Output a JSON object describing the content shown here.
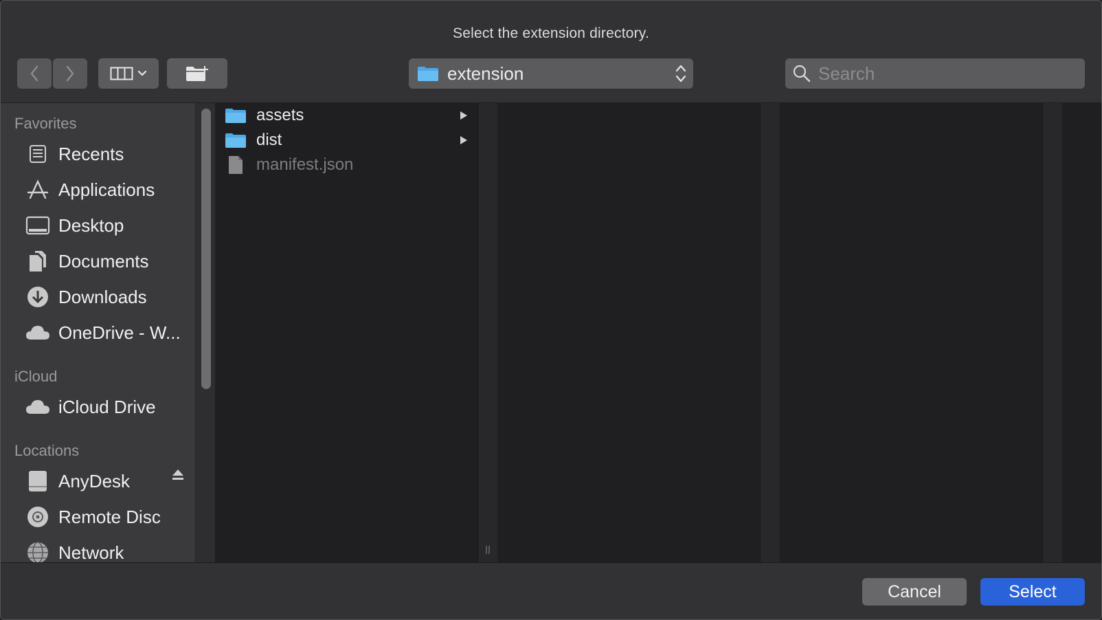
{
  "dialog": {
    "title": "Select the extension directory."
  },
  "toolbar": {
    "back_icon": "chevron-left-icon",
    "forward_icon": "chevron-right-icon",
    "view_icon": "column-view-icon",
    "new_folder_icon": "new-folder-icon",
    "path_label": "extension",
    "search_placeholder": "Search"
  },
  "sidebar": {
    "favorites_header": "Favorites",
    "favorites": [
      {
        "label": "Recents",
        "icon": "recents-icon"
      },
      {
        "label": "Applications",
        "icon": "applications-icon"
      },
      {
        "label": "Desktop",
        "icon": "desktop-icon"
      },
      {
        "label": "Documents",
        "icon": "documents-icon"
      },
      {
        "label": "Downloads",
        "icon": "downloads-icon"
      },
      {
        "label": "OneDrive - W...",
        "icon": "cloud-icon"
      }
    ],
    "icloud_header": "iCloud",
    "icloud": [
      {
        "label": "iCloud Drive",
        "icon": "cloud-icon"
      }
    ],
    "locations_header": "Locations",
    "locations": [
      {
        "label": "AnyDesk",
        "icon": "drive-icon"
      },
      {
        "label": "Remote Disc",
        "icon": "disc-icon"
      },
      {
        "label": "Network",
        "icon": "network-icon"
      }
    ]
  },
  "files": [
    {
      "name": "assets",
      "type": "folder"
    },
    {
      "name": "dist",
      "type": "folder"
    },
    {
      "name": "manifest.json",
      "type": "file"
    }
  ],
  "buttons": {
    "cancel": "Cancel",
    "select": "Select"
  },
  "colors": {
    "folder": "#5fb4ec",
    "accent": "#2a62d9"
  }
}
